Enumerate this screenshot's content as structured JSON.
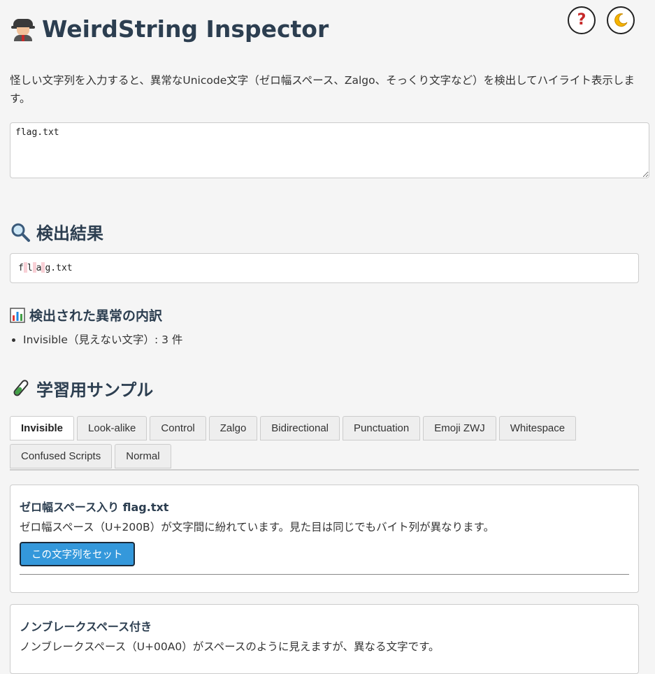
{
  "app": {
    "title": "WeirdString Inspector",
    "description": "怪しい文字列を入力すると、異常なUnicode文字（ゼロ幅スペース、Zalgo、そっくり文字など）を検出してハイライト表示します。"
  },
  "header_buttons": {
    "help_symbol": "?",
    "theme_symbol": "☽"
  },
  "input": {
    "value": "f​l​a​g.txt"
  },
  "results": {
    "heading": "検出結果",
    "segments": [
      "f",
      "l",
      "a",
      "g.txt"
    ],
    "breakdown_heading": "検出された異常の内訳",
    "breakdown_items": [
      "Invisible（見えない文字）: 3 件"
    ]
  },
  "samples": {
    "heading": "学習用サンプル",
    "tabs": [
      "Invisible",
      "Look-alike",
      "Control",
      "Zalgo",
      "Bidirectional",
      "Punctuation",
      "Emoji ZWJ",
      "Whitespace",
      "Confused Scripts",
      "Normal"
    ],
    "active_tab": "Invisible",
    "cards": [
      {
        "title": "ゼロ幅スペース入り flag.txt",
        "description": "ゼロ幅スペース（U+200B）が文字間に紛れています。見た目は同じでもバイト列が異なります。",
        "button": "この文字列をセット"
      },
      {
        "title": "ノンブレークスペース付き",
        "description": "ノンブレークスペース（U+00A0）がスペースのように見えますが、異なる文字です。"
      }
    ]
  },
  "colors": {
    "heading": "#2c3e50",
    "accent_button": "#3498db",
    "highlight_invisible": "#f8d0d6",
    "background": "#f5f5f5"
  }
}
